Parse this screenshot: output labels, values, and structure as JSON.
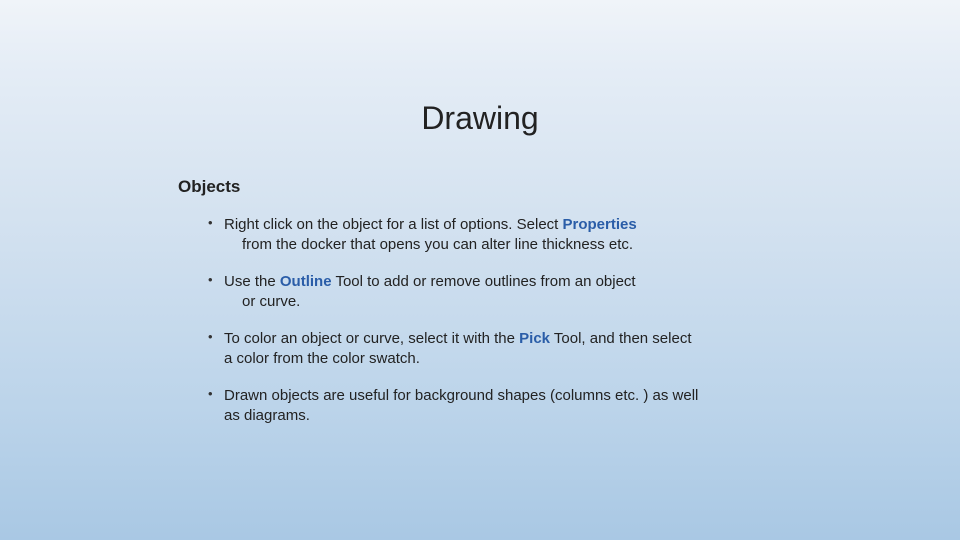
{
  "title": "Drawing",
  "subheading": "Objects",
  "bullets": {
    "b1": {
      "pre": "Right click on the object for a list of options. Select ",
      "hl": "Properties",
      "line2": "from the docker that opens you can alter line thickness etc."
    },
    "b2": {
      "pre": "Use the ",
      "hl": "Outline",
      "mid": " Tool to add or remove outlines from an object",
      "line2": "or curve."
    },
    "b3": {
      "pre": "To color an object or curve, select it with the ",
      "hl": "Pick",
      "mid": " Tool, and then select",
      "line2": "a color from the color swatch."
    },
    "b4": {
      "text": "Drawn objects are useful for background shapes (columns  etc. ) as well",
      "line2": "as diagrams."
    }
  }
}
